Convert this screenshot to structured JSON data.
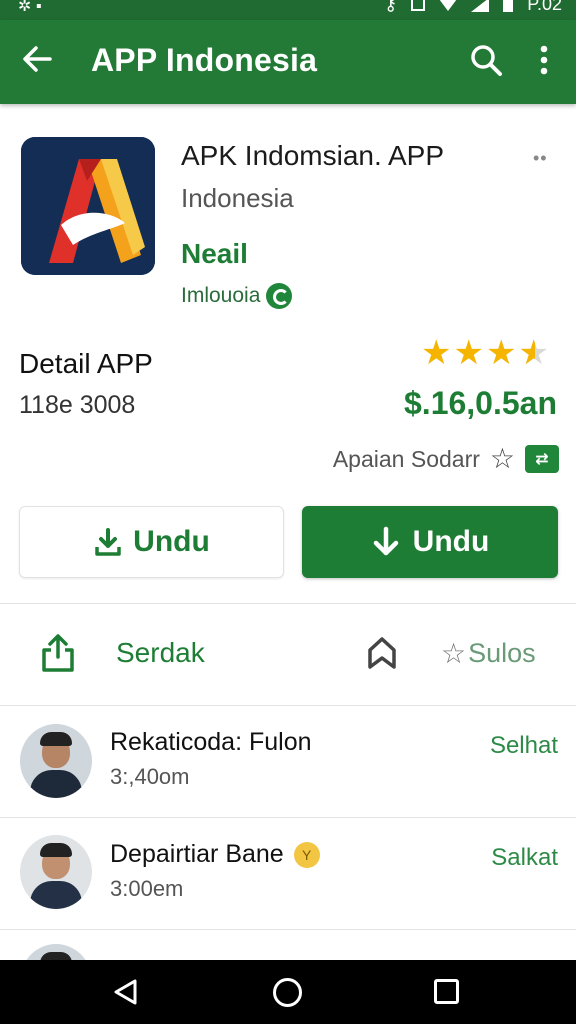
{
  "status_bar": {
    "time": "P.02"
  },
  "app_bar": {
    "title": "APP Indonesia",
    "back_icon": "arrow-left-icon",
    "search_icon": "search-icon",
    "more_icon": "more-vert-icon"
  },
  "app": {
    "name": "APK Indomsian. APP",
    "region": "Indonesia",
    "install_label": "Neail",
    "developer": "Imlouoia",
    "developer_verified": true
  },
  "detail": {
    "title": "Detail APP",
    "size": "118e 3008",
    "rating_stars": 3.5,
    "price": "$.16,0.5an",
    "category": "Apaian Sodarr"
  },
  "buttons": {
    "download_outline_label": "Undu",
    "download_primary_label": "Undu"
  },
  "actions": {
    "share_label": "Serdak",
    "review_label": "Sulos"
  },
  "list": [
    {
      "title": "Rekaticoda: Fulon",
      "subtitle": "3:,40om",
      "action": "Selhat"
    },
    {
      "title": "Depairtiar Bane",
      "subtitle": "3:00em",
      "action": "Salkat",
      "badge": "Y"
    }
  ],
  "colors": {
    "brand_green": "#237a36",
    "accent_green": "#1e7d34",
    "star_gold": "#f4b400",
    "nav_bg": "#000000"
  }
}
